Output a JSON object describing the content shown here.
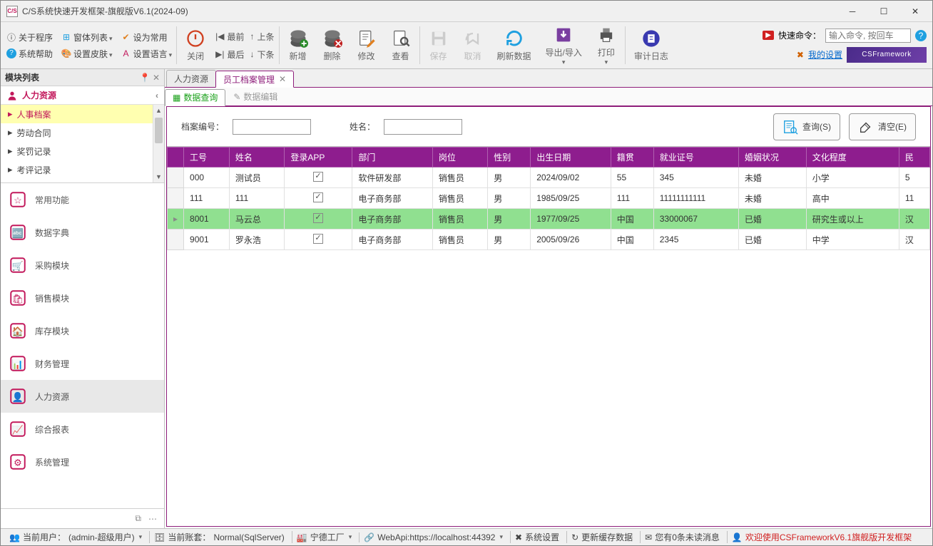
{
  "window": {
    "title": "C/S系统快速开发框架-旗舰版V6.1(2024-09)"
  },
  "menu": {
    "about": "关于程序",
    "formlist": "窗体列表",
    "setdefault": "设为常用",
    "syshelp": "系统帮助",
    "skin": "设置皮肤",
    "lang": "设置语言"
  },
  "toolbar": {
    "close": "关闭",
    "nav": {
      "first": "最前",
      "prev": "上条",
      "last": "最后",
      "next": "下条"
    },
    "add": "新增",
    "del": "删除",
    "edit": "修改",
    "view": "查看",
    "save": "保存",
    "cancel": "取消",
    "refresh": "刷新数据",
    "export": "导出/导入",
    "print": "打印",
    "audit": "审计日志"
  },
  "quick": {
    "label": "快速命令：",
    "placeholder": "输入命令, 按回车",
    "mysettings": "我的设置",
    "banner": "CSFramework"
  },
  "sidebar": {
    "header": "模块列表",
    "section": "人力资源",
    "tree": [
      "人事档案",
      "劳动合同",
      "奖罚记录",
      "考评记录"
    ],
    "modules": [
      "常用功能",
      "数据字典",
      "采购模块",
      "销售模块",
      "库存模块",
      "财务管理",
      "人力资源",
      "综合报表",
      "系统管理"
    ]
  },
  "tabs": {
    "doc": [
      "人力资源",
      "员工档案管理"
    ],
    "sub": [
      "数据查询",
      "数据编辑"
    ]
  },
  "search": {
    "code_lbl": "档案编号：",
    "name_lbl": "姓名：",
    "query": "查询(S)",
    "clear": "清空(E)"
  },
  "grid": {
    "cols": [
      "工号",
      "姓名",
      "登录APP",
      "部门",
      "岗位",
      "性别",
      "出生日期",
      "籍贯",
      "就业证号",
      "婚姻状况",
      "文化程度",
      "民"
    ],
    "rows": [
      {
        "id": "000",
        "name": "测试员",
        "app": true,
        "dept": "软件研发部",
        "post": "销售员",
        "sex": "男",
        "dob": "2024/09/02",
        "native": "55",
        "cert": "345",
        "marital": "未婚",
        "edu": "小学",
        "nation": "5"
      },
      {
        "id": "111",
        "name": "111",
        "app": true,
        "dept": "电子商务部",
        "post": "销售员",
        "sex": "男",
        "dob": "1985/09/25",
        "native": "111",
        "cert": "11111111111",
        "marital": "未婚",
        "edu": "高中",
        "nation": "11"
      },
      {
        "id": "8001",
        "name": "马云总",
        "app": true,
        "dept": "电子商务部",
        "post": "销售员",
        "sex": "男",
        "dob": "1977/09/25",
        "native": "中国",
        "cert": "33000067",
        "marital": "已婚",
        "edu": "研究生或以上",
        "nation": "汉",
        "hl": true
      },
      {
        "id": "9001",
        "name": "罗永浩",
        "app": true,
        "dept": "电子商务部",
        "post": "销售员",
        "sex": "男",
        "dob": "2005/09/26",
        "native": "中国",
        "cert": "2345",
        "marital": "已婚",
        "edu": "中学",
        "nation": "汉"
      }
    ]
  },
  "status": {
    "user_lbl": "当前用户：",
    "user": "(admin-超级用户)",
    "acct_lbl": "当前账套：",
    "acct": "Normal(SqlServer)",
    "factory": "宁德工厂",
    "webapi": "WebApi:https://localhost:44392",
    "syssetting": "系统设置",
    "updatecache": "更新缓存数据",
    "unread": "您有0条未读消息",
    "welcome": "欢迎使用CSFrameworkV6.1旗舰版开发框架"
  }
}
